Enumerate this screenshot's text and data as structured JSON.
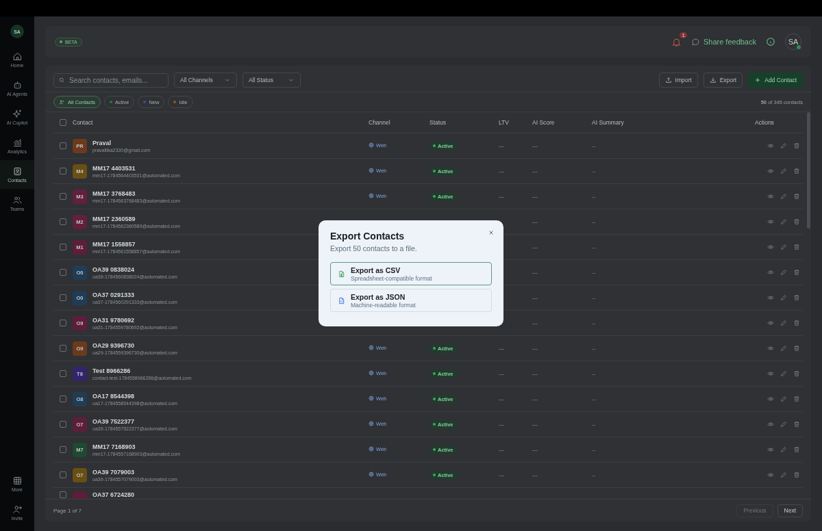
{
  "sidebar": {
    "avatar": "SA",
    "items": [
      {
        "label": "Home",
        "selected": false
      },
      {
        "label": "AI Agents",
        "selected": false
      },
      {
        "label": "AI Copilot",
        "selected": false
      },
      {
        "label": "Analytics",
        "selected": false
      },
      {
        "label": "Contacts",
        "selected": true
      },
      {
        "label": "Teams",
        "selected": false
      }
    ],
    "bottom_items": [
      {
        "label": "More"
      },
      {
        "label": "Invite"
      }
    ]
  },
  "header": {
    "badge": "BETA",
    "notifications": "1",
    "feedback": "Share feedback",
    "avatar": "SA"
  },
  "toolbar": {
    "search": {
      "placeholder": "Search contacts, emails..."
    },
    "filters": [
      "All Channels",
      "All Status"
    ],
    "buttons": [
      {
        "label": "Import",
        "kind": "import"
      },
      {
        "label": "Export",
        "kind": "export"
      },
      {
        "label": "Add Contact",
        "kind": "add"
      }
    ]
  },
  "chips": [
    {
      "label": "All Contacts",
      "selected": true
    },
    {
      "label": "Active",
      "selected": false,
      "color": "#1f7a45"
    },
    {
      "label": "New",
      "selected": false,
      "color": "#4048a8"
    },
    {
      "label": "Idle",
      "selected": false,
      "color": "#8a5a1e"
    }
  ],
  "count": "**50** of 345 contacts",
  "table": {
    "select_all": false,
    "columns": [
      "Contact",
      "Channel",
      "Status",
      "LTV",
      "AI Score",
      "AI Summary",
      "Actions"
    ],
    "rows": [
      {
        "checked": false,
        "initials": "PR",
        "color": "#6b3a1c",
        "name": "Praval",
        "email": "pravallika2330@gmail.com",
        "channel": "Web",
        "status": "Active",
        "ltv": "—",
        "ai_score": "—",
        "ai_summary": "--"
      },
      {
        "checked": false,
        "initials": "M4",
        "color": "#6a4f14",
        "name": "MM17 4403531",
        "email": "mm17-1784564403531@automated.com",
        "channel": "Web",
        "status": "Active",
        "ltv": "—",
        "ai_score": "—",
        "ai_summary": "--"
      },
      {
        "checked": false,
        "initials": "M3",
        "color": "#62203c",
        "name": "MM17 3768483",
        "email": "mm17-1784563768483@automated.com",
        "channel": "Web",
        "status": "Active",
        "ltv": "—",
        "ai_score": "—",
        "ai_summary": "--"
      },
      {
        "checked": false,
        "initials": "M2",
        "color": "#62203c",
        "name": "MM17 2360589",
        "email": "mm17-1784562360589@automated.com",
        "ai_score": "—",
        "ai_summary": "--"
      },
      {
        "checked": false,
        "initials": "M1",
        "color": "#5e1e3a",
        "name": "MM17 1558857",
        "email": "mm17-1784561558857@automated.com",
        "ai_score": "—",
        "ai_summary": "--"
      },
      {
        "checked": false,
        "initials": "O0",
        "color": "#1f3d57",
        "name": "OA39 0838024",
        "email": "oa39-1784560838024@automated.com",
        "ai_score": "—",
        "ai_summary": "--"
      },
      {
        "checked": false,
        "initials": "O0",
        "color": "#1f3d57",
        "name": "OA37 0291333",
        "email": "oa37-1784560291333@automated.com",
        "ai_score": "—",
        "ai_summary": "--"
      },
      {
        "checked": false,
        "initials": "O9",
        "color": "#5e1e3a",
        "name": "OA31 9780692",
        "email": "oa31-1784559780692@automated.com",
        "ai_score": "—",
        "ai_summary": "--"
      },
      {
        "checked": false,
        "initials": "O9",
        "color": "#6b3a1c",
        "name": "OA29 9396730",
        "email": "oa29-1784559396730@automated.com",
        "channel": "Web",
        "status": "Active",
        "ltv": "—",
        "ai_score": "—",
        "ai_summary": "--"
      },
      {
        "checked": false,
        "initials": "T8",
        "color": "#35246b",
        "name": "Test 8966286",
        "email": "contact-test-1784558966286@automated.com",
        "channel": "Web",
        "status": "Active",
        "ltv": "—",
        "ai_score": "—",
        "ai_summary": "--"
      },
      {
        "checked": false,
        "initials": "O8",
        "color": "#1f3d57",
        "name": "OA17 8544398",
        "email": "oa17-1784558544398@automated.com",
        "channel": "Web",
        "status": "Active",
        "ltv": "—",
        "ai_score": "—",
        "ai_summary": "--"
      },
      {
        "checked": false,
        "initials": "O7",
        "color": "#5e1e3a",
        "name": "OA39 7522377",
        "email": "oa39-1784557522377@automated.com",
        "channel": "Web",
        "status": "Active",
        "ltv": "—",
        "ai_score": "—",
        "ai_summary": "--"
      },
      {
        "checked": false,
        "initials": "M7",
        "color": "#1d4a30",
        "name": "MM17 7168903",
        "email": "mm17-1784557168903@automated.com",
        "channel": "Web",
        "status": "Active",
        "ltv": "—",
        "ai_score": "—",
        "ai_summary": "--"
      },
      {
        "checked": false,
        "initials": "O7",
        "color": "#6a4f14",
        "name": "OA39 7079003",
        "email": "oa39-1784557079003@automated.com",
        "channel": "Web",
        "status": "Active",
        "ltv": "—",
        "ai_score": "—",
        "ai_summary": "--"
      },
      {
        "checked": false,
        "color": "#5e1e3a",
        "name": "OA37 6724280"
      }
    ]
  },
  "footer": {
    "page": "Page 1 of 7",
    "buttons": [
      {
        "label": "Previous",
        "disabled": true
      },
      {
        "label": "Next",
        "disabled": false
      }
    ]
  },
  "modal": {
    "title": "Export Contacts",
    "subtitle": "Export 50 contacts to a file.",
    "options": [
      {
        "kind": "csv",
        "title": "Export as CSV",
        "description": "Spreadsheet-compatible format",
        "selected": true
      },
      {
        "kind": "json",
        "title": "Export as JSON",
        "description": "Machine-readable format",
        "selected": false
      }
    ]
  }
}
